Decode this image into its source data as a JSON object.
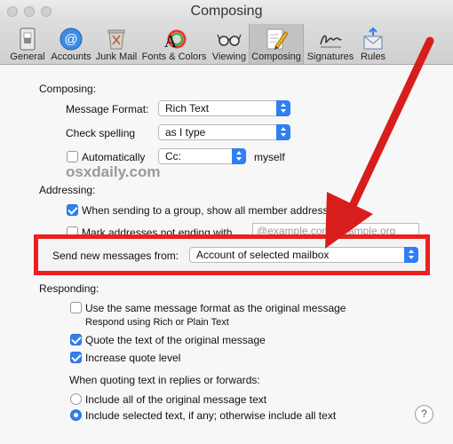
{
  "window": {
    "title": "Composing"
  },
  "toolbar": {
    "items": [
      {
        "label": "General",
        "icon": "general-switch-icon"
      },
      {
        "label": "Accounts",
        "icon": "at-sign-icon"
      },
      {
        "label": "Junk Mail",
        "icon": "trash-bin-icon"
      },
      {
        "label": "Fonts & Colors",
        "icon": "fonts-colors-icon"
      },
      {
        "label": "Viewing",
        "icon": "glasses-icon"
      },
      {
        "label": "Composing",
        "icon": "pencil-icon",
        "selected": true
      },
      {
        "label": "Signatures",
        "icon": "signature-icon"
      },
      {
        "label": "Rules",
        "icon": "rules-envelope-icon"
      }
    ]
  },
  "composing": {
    "header": "Composing:",
    "message_format_label": "Message Format:",
    "message_format_value": "Rich Text",
    "check_spelling_label": "Check spelling",
    "check_spelling_value": "as I type",
    "automatically_label": "Automatically",
    "automatically_checked": false,
    "cc_value": "Cc:",
    "myself_label": "myself"
  },
  "watermark": "osxdaily.com",
  "addressing": {
    "header": "Addressing:",
    "group_label": "When sending to a group, show all member addresses",
    "group_checked": true,
    "mark_label": "Mark addresses not ending with",
    "mark_checked": false,
    "mark_placeholder": "@example.com, example.org"
  },
  "send_from": {
    "label": "Send new messages from:",
    "value": "Account of selected mailbox"
  },
  "responding": {
    "header": "Responding:",
    "same_format_label": "Use the same message format as the original message",
    "same_format_checked": false,
    "same_format_sub": "Respond using Rich or Plain Text",
    "quote_label": "Quote the text of the original message",
    "quote_checked": true,
    "increase_label": "Increase quote level",
    "increase_checked": true,
    "when_quoting_label": "When quoting text in replies or forwards:",
    "include_all_label": "Include all of the original message text",
    "include_selected_label": "Include selected text, if any; otherwise include all text",
    "selected_option": "include_selected"
  },
  "help": {
    "label": "?"
  },
  "colors": {
    "accent": "#2f7ff2",
    "highlight_box": "#ec2020"
  }
}
